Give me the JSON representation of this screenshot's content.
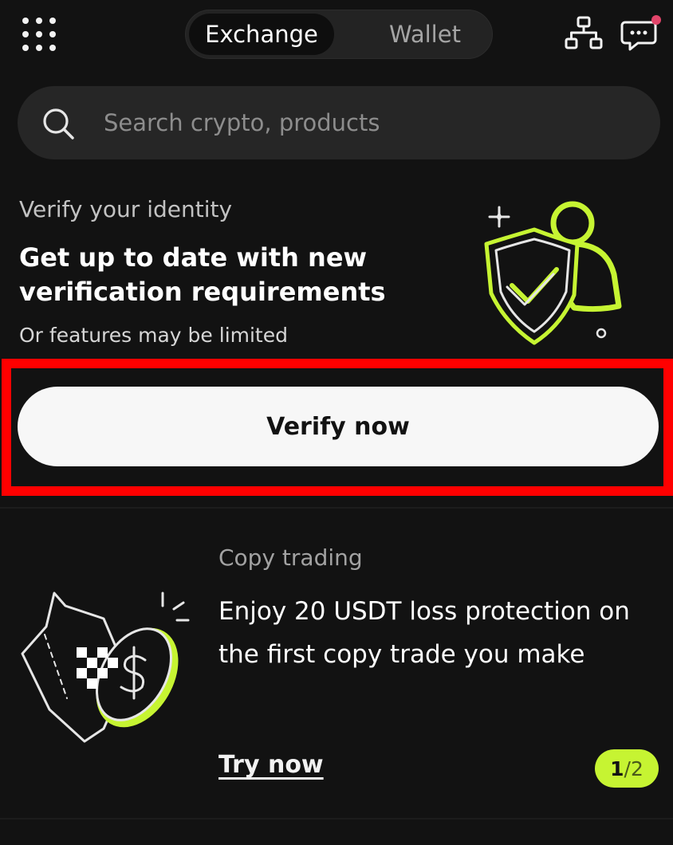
{
  "header": {
    "tabs": [
      {
        "label": "Exchange",
        "active": true
      },
      {
        "label": "Wallet",
        "active": false
      }
    ],
    "icons": [
      "apps-grid-icon",
      "account-hierarchy-icon",
      "chat-icon"
    ],
    "notification_dot_color": "#e2456a"
  },
  "search": {
    "placeholder": "Search crypto, products"
  },
  "identity_card": {
    "eyebrow": "Verify your identity",
    "headline": "Get up to date with new verification requirements",
    "note": "Or features may be limited",
    "button_label": "Verify now"
  },
  "copy_trading_card": {
    "eyebrow": "Copy trading",
    "headline": "Enjoy 20 USDT loss protection on the first copy trade you make",
    "link_label": "Try now",
    "pager_current": "1",
    "pager_total": "/2"
  },
  "colors": {
    "background": "#121212",
    "accent": "#c6f432",
    "highlight": "#ff0000"
  }
}
